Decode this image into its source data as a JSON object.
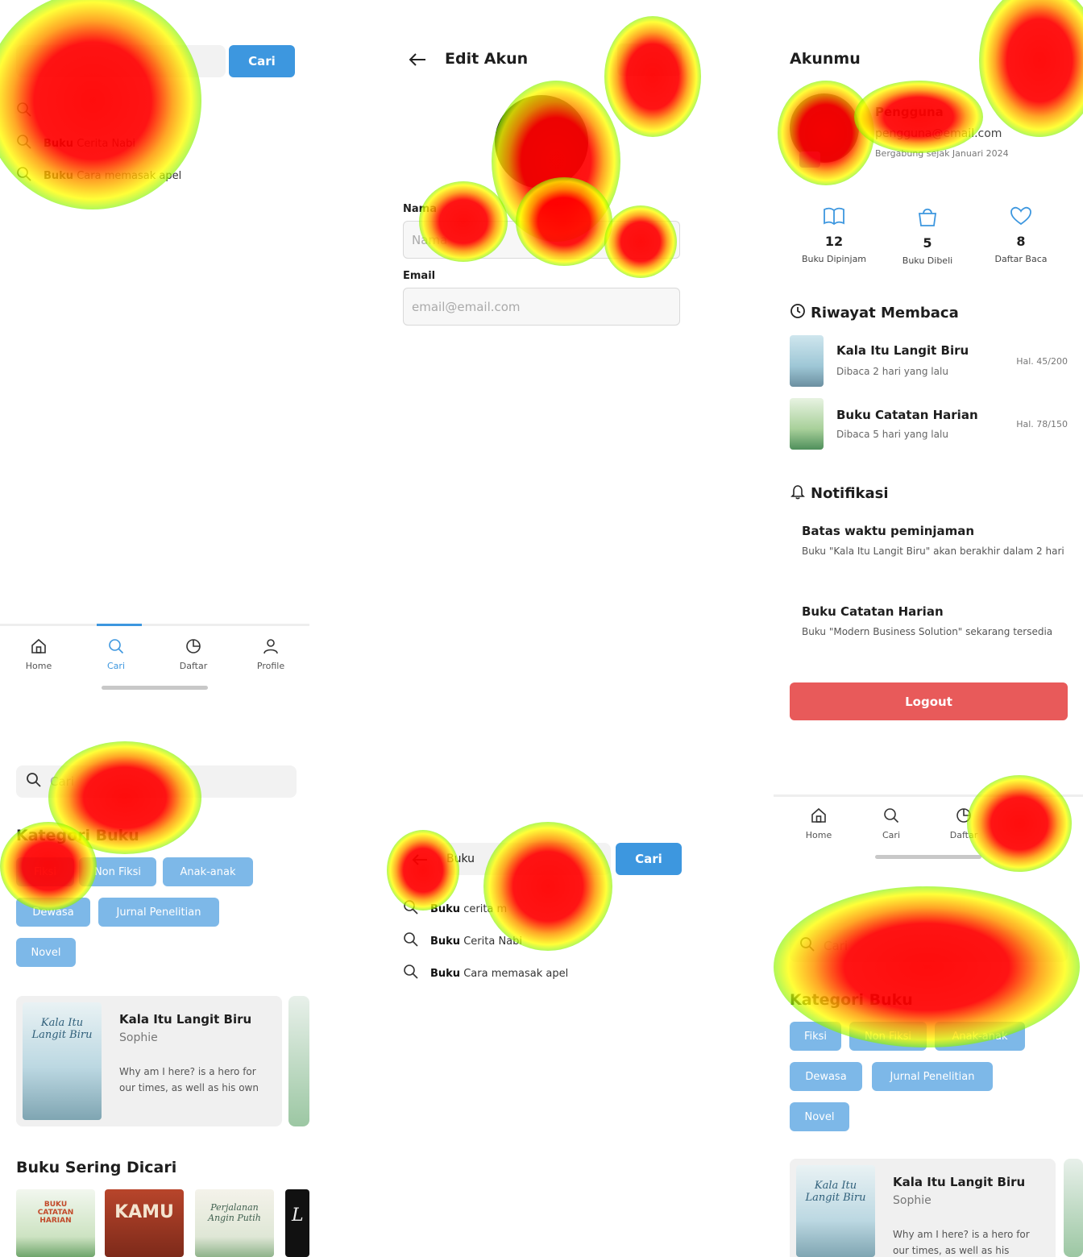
{
  "colors": {
    "accent": "#3d97df",
    "chip": "#7db8e8",
    "logout": "#e85a5a"
  },
  "screen1": {
    "search_button": "Cari",
    "suggestions": [
      {
        "bold": "",
        "rest": ""
      },
      {
        "bold": "Buku",
        "rest": " Cerita Nabi"
      },
      {
        "bold": "Buku",
        "rest": " Cara memasak apel"
      }
    ],
    "nav": [
      {
        "label": "Home",
        "icon": "home-icon"
      },
      {
        "label": "Cari",
        "icon": "search-icon"
      },
      {
        "label": "Daftar",
        "icon": "clock-icon"
      },
      {
        "label": "Profile",
        "icon": "user-icon"
      }
    ]
  },
  "screen2": {
    "title": "Edit Akun",
    "name_label": "Nama",
    "name_placeholder": "Nama",
    "email_label": "Email",
    "email_placeholder": "email@email.com"
  },
  "screen3": {
    "title": "Akunmu",
    "user_name": "Pengguna",
    "user_email": "pengguna@email.com",
    "member_since": "Bergabung sejak Januari 2024",
    "stats": [
      {
        "value": "12",
        "label": "Buku Dipinjam",
        "icon": "book-open-icon"
      },
      {
        "value": "5",
        "label": "Buku Dibeli",
        "icon": "shopping-bag-icon"
      },
      {
        "value": "8",
        "label": "Daftar Baca",
        "icon": "heart-icon"
      }
    ],
    "history_title": "Riwayat Membaca",
    "history": [
      {
        "title": "Kala Itu Langit Biru",
        "when": "Dibaca 2 hari yang lalu",
        "page": "Hal. 45/200"
      },
      {
        "title": "Buku Catatan Harian",
        "when": "Dibaca 5 hari yang lalu",
        "page": "Hal. 78/150"
      }
    ],
    "notif_title": "Notifikasi",
    "notifications": [
      {
        "title": "Batas waktu peminjaman",
        "desc": "Buku \"Kala Itu Langit Biru\" akan berakhir dalam 2 hari"
      },
      {
        "title": "Buku Catatan Harian",
        "desc": "Buku \"Modern Business Solution\" sekarang tersedia"
      }
    ],
    "logout": "Logout"
  },
  "screen4": {
    "search_placeholder": "Cari",
    "category_title": "Kategori Buku",
    "chips": [
      "Fiksi",
      "Non Fiksi",
      "Anak-anak",
      "Dewasa",
      "Jurnal Penelitian",
      "Novel"
    ],
    "featured": {
      "title": "Kala Itu Langit Biru",
      "author": "Sophie",
      "desc": "Why am I here? is a hero for our times, as well as his own",
      "cover_text": "Kala Itu Langit Biru"
    },
    "popular_title": "Buku Sering Dicari",
    "popular": [
      {
        "cover_text": "BUKU CATATAN HARIAN"
      },
      {
        "cover_text": "KAMU"
      },
      {
        "cover_text": "Perjalanan Angin Putih"
      },
      {
        "cover_text": "L"
      }
    ]
  },
  "screen5": {
    "search_value": "Buku",
    "search_button": "Cari",
    "suggestions": [
      {
        "bold": "Buku",
        "rest": " cerita m"
      },
      {
        "bold": "Buku",
        "rest": " Cerita Nabi"
      },
      {
        "bold": "Buku",
        "rest": " Cara memasak apel"
      }
    ]
  },
  "screen6": {
    "nav": [
      {
        "label": "Home",
        "icon": "home-icon"
      },
      {
        "label": "Cari",
        "icon": "search-icon"
      },
      {
        "label": "Daftar",
        "icon": "clock-icon"
      }
    ],
    "search_placeholder": "Cari",
    "category_title": "Kategori Buku",
    "chips": [
      "Fiksi",
      "Non Fiksi",
      "Anak-anak",
      "Dewasa",
      "Jurnal Penelitian",
      "Novel"
    ],
    "featured": {
      "title": "Kala Itu Langit Biru",
      "author": "Sophie",
      "desc": "Why am I here? is a hero for our times, as well as his",
      "cover_text": "Kala Itu Langit Biru"
    }
  }
}
